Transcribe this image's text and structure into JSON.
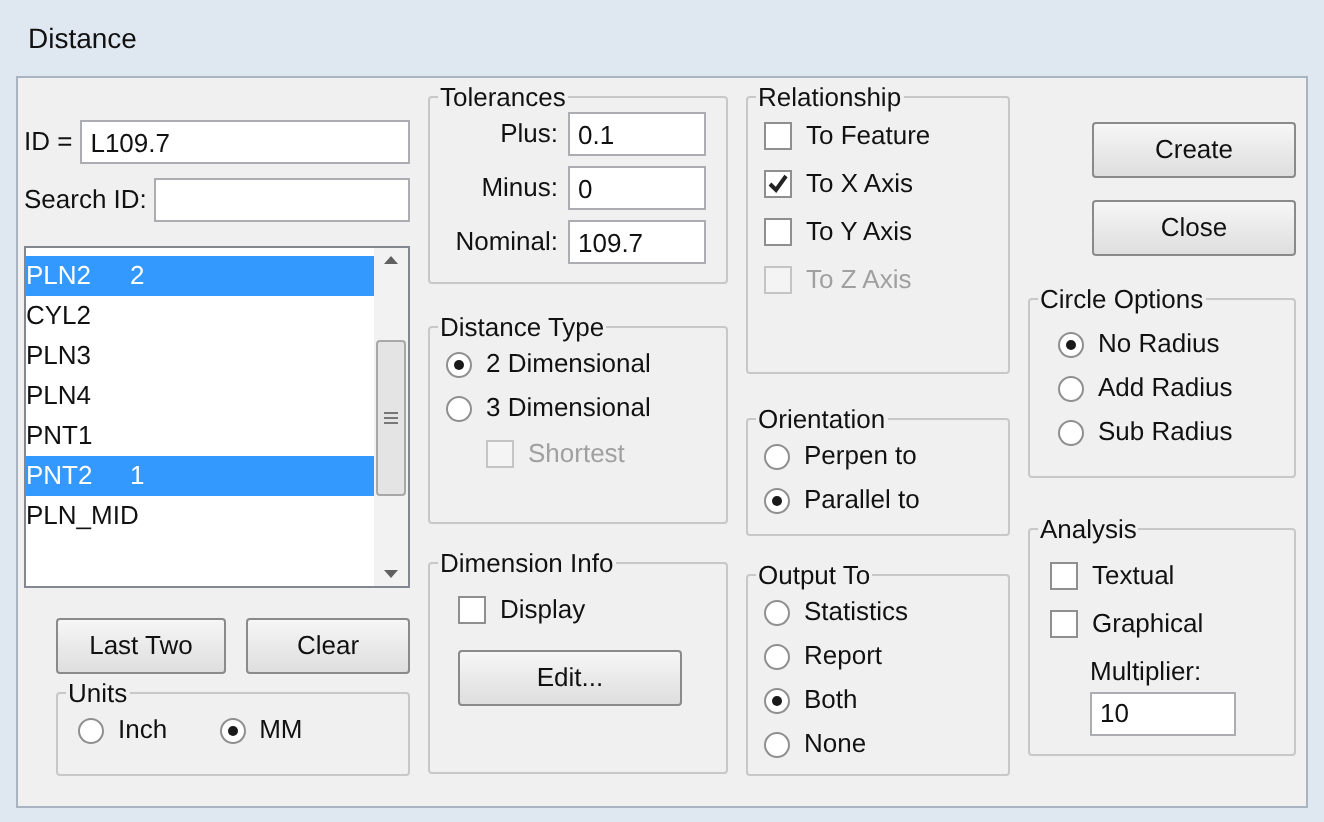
{
  "window": {
    "title": "Distance"
  },
  "id_field": {
    "label": "ID =",
    "value": "L109.7"
  },
  "search_field": {
    "label": "Search ID:"
  },
  "feature_list": [
    {
      "label": "PLN2",
      "order": "2",
      "selected": true
    },
    {
      "label": "CYL2",
      "selected": false
    },
    {
      "label": "PLN3",
      "selected": false
    },
    {
      "label": "PLN4",
      "selected": false
    },
    {
      "label": "PNT1",
      "selected": false
    },
    {
      "label": "PNT2",
      "order": "1",
      "selected": true
    },
    {
      "label": "PLN_MID",
      "selected": false
    }
  ],
  "list_buttons": [
    "Last Two",
    "Clear"
  ],
  "units": {
    "title": "Units",
    "options": [
      {
        "label": "Inch",
        "selected": false
      },
      {
        "label": "MM",
        "selected": true
      }
    ]
  },
  "tolerances": {
    "title": "Tolerances",
    "fields": [
      {
        "label": "Plus:",
        "value": "0.1"
      },
      {
        "label": "Minus:",
        "value": "0"
      },
      {
        "label": "Nominal:",
        "value": "109.7"
      }
    ]
  },
  "distance_type": {
    "title": "Distance Type",
    "options": [
      {
        "label": "2 Dimensional",
        "selected": true
      },
      {
        "label": "3 Dimensional",
        "selected": false
      }
    ],
    "shortest": {
      "label": "Shortest",
      "checked": false,
      "disabled": true
    }
  },
  "dimension_info": {
    "title": "Dimension Info",
    "display": {
      "label": "Display",
      "checked": false
    },
    "button": "Edit..."
  },
  "relationship": {
    "title": "Relationship",
    "options": [
      {
        "label": "To Feature",
        "checked": false,
        "disabled": false
      },
      {
        "label": "To X Axis",
        "checked": true,
        "disabled": false
      },
      {
        "label": "To Y Axis",
        "checked": false,
        "disabled": false
      },
      {
        "label": "To Z Axis",
        "checked": false,
        "disabled": true
      }
    ]
  },
  "orientation": {
    "title": "Orientation",
    "options": [
      {
        "label": "Perpen to",
        "selected": false
      },
      {
        "label": "Parallel to",
        "selected": true
      }
    ]
  },
  "output_to": {
    "title": "Output To",
    "options": [
      {
        "label": "Statistics",
        "selected": false
      },
      {
        "label": "Report",
        "selected": false
      },
      {
        "label": "Both",
        "selected": true
      },
      {
        "label": "None",
        "selected": false
      }
    ]
  },
  "actions": [
    "Create",
    "Close"
  ],
  "circle_options": {
    "title": "Circle Options",
    "options": [
      {
        "label": "No Radius",
        "selected": true
      },
      {
        "label": "Add Radius",
        "selected": false
      },
      {
        "label": "Sub Radius",
        "selected": false
      }
    ]
  },
  "analysis": {
    "title": "Analysis",
    "checks": [
      {
        "label": "Textual",
        "checked": false
      },
      {
        "label": "Graphical",
        "checked": false
      }
    ],
    "multiplier": {
      "label": "Multiplier:",
      "value": "10"
    }
  }
}
